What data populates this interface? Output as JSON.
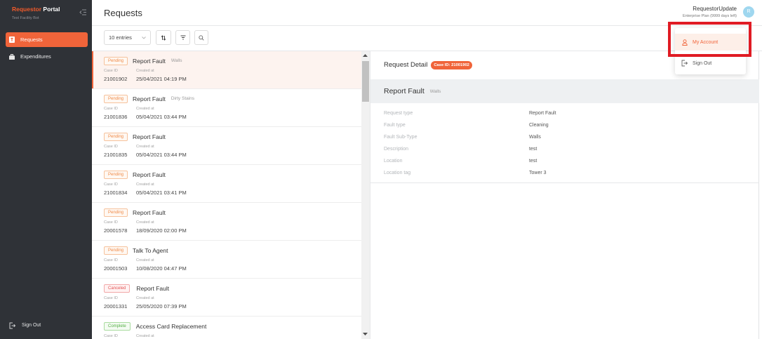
{
  "sidebar": {
    "brand_accent": "Requestor",
    "brand_main": "Portal",
    "subtitle": "Test Facility Bot",
    "collapse_icon": "collapse-sidebar-icon",
    "items": [
      {
        "label": "Requests",
        "icon": "document-icon",
        "active": true
      },
      {
        "label": "Expenditures",
        "icon": "briefcase-icon",
        "active": false
      }
    ],
    "sign_out": {
      "label": "Sign Out",
      "icon": "sign-out-icon"
    }
  },
  "header": {
    "title": "Requests",
    "user_name": "RequestorUpdate",
    "plan": "Enterprise Plan (9999 days left)",
    "avatar_initial": "R"
  },
  "toolbar": {
    "entries_select": "10 entries",
    "sort_icon": "sort-icon",
    "filter_icon": "filter-icon",
    "search_icon": "search-icon"
  },
  "user_menu": {
    "items": [
      {
        "label": "My Account",
        "icon": "user-icon",
        "highlighted": true
      },
      {
        "label": "Sign Out",
        "icon": "sign-out-icon",
        "highlighted": false
      }
    ]
  },
  "list": {
    "case_id_label": "Case ID",
    "created_at_label": "Created at",
    "items": [
      {
        "status": "Pending",
        "title": "Report Fault",
        "subtype": "Walls",
        "case_id": "21001902",
        "created_at": "25/04/2021 04:19 PM",
        "selected": true
      },
      {
        "status": "Pending",
        "title": "Report Fault",
        "subtype": "Dirty Stains",
        "case_id": "21001836",
        "created_at": "05/04/2021 03:44 PM"
      },
      {
        "status": "Pending",
        "title": "Report Fault",
        "case_id": "21001835",
        "created_at": "05/04/2021 03:44 PM"
      },
      {
        "status": "Pending",
        "title": "Report Fault",
        "case_id": "21001834",
        "created_at": "05/04/2021 03:41 PM"
      },
      {
        "status": "Pending",
        "title": "Report Fault",
        "case_id": "20001578",
        "created_at": "18/09/2020 02:00 PM"
      },
      {
        "status": "Pending",
        "title": "Talk To Agent",
        "case_id": "20001503",
        "created_at": "10/08/2020 04:47 PM"
      },
      {
        "status": "Canceled",
        "title": "Report Fault",
        "case_id": "20001331",
        "created_at": "25/05/2020 07:39 PM"
      },
      {
        "status": "Complete",
        "title": "Access Card Replacement"
      }
    ]
  },
  "detail": {
    "heading": "Request Detail",
    "case_badge": "Case ID: 21001902",
    "title": "Report Fault",
    "subtitle": "Walls",
    "fields": [
      {
        "label": "Request type",
        "value": "Report Fault"
      },
      {
        "label": "Fault type",
        "value": "Cleaning"
      },
      {
        "label": "Fault Sub-Type",
        "value": "Walls"
      },
      {
        "label": "Description",
        "value": "test"
      },
      {
        "label": "Location",
        "value": "test"
      },
      {
        "label": "Location tag",
        "value": "Tower 3"
      }
    ]
  },
  "colors": {
    "accent": "#f0643a",
    "sidebar_bg": "#2f3237",
    "status_pending": "#ef8a48",
    "status_canceled": "#e25555",
    "status_complete": "#55b046",
    "avatar": "#9fd7ef",
    "highlight_box": "#e01b24"
  }
}
